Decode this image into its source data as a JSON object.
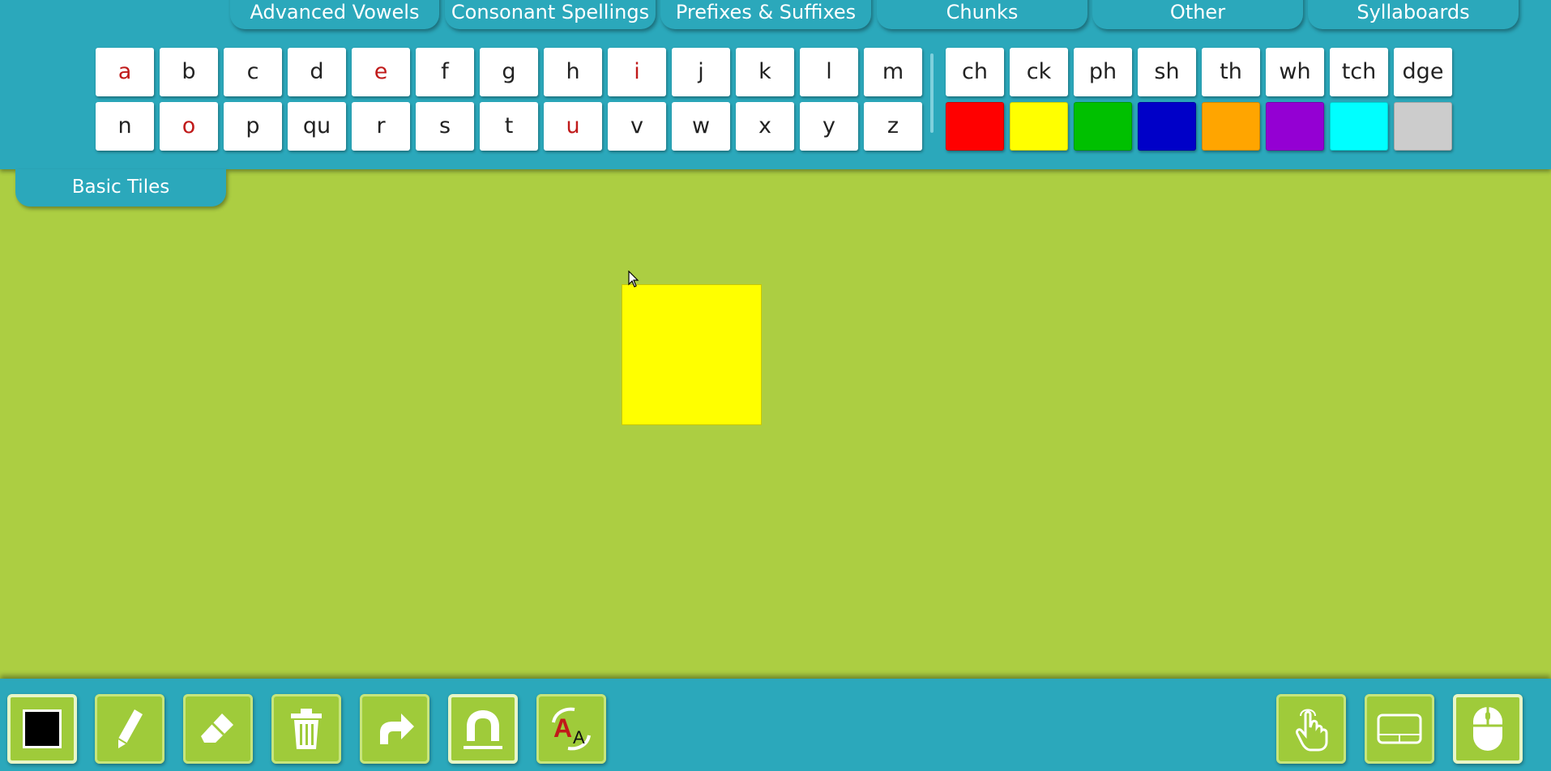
{
  "category_tabs": [
    "Advanced Vowels",
    "Consonant Spellings",
    "Prefixes & Suffixes",
    "Chunks",
    "Other",
    "Syllaboards"
  ],
  "letters_row1": [
    "a",
    "b",
    "c",
    "d",
    "e",
    "f",
    "g",
    "h",
    "i",
    "j",
    "k",
    "l",
    "m"
  ],
  "letters_row2": [
    "n",
    "o",
    "p",
    "qu",
    "r",
    "s",
    "t",
    "u",
    "v",
    "w",
    "x",
    "y",
    "z"
  ],
  "digraphs": [
    "ch",
    "ck",
    "ph",
    "sh",
    "th",
    "wh",
    "tch",
    "dge"
  ],
  "vowels": [
    "a",
    "e",
    "i",
    "o",
    "u"
  ],
  "swatches": [
    "#ff0000",
    "#ffff00",
    "#00c000",
    "#0000c8",
    "#ffa500",
    "#9400d3",
    "#00ffff",
    "#cccccc"
  ],
  "basic_tiles_label": "Basic Tiles",
  "placed_tile_color": "#ffff00",
  "toolbar": {
    "color_icon": "color-picker-icon",
    "pencil_icon": "pencil-icon",
    "eraser_icon": "eraser-icon",
    "trash_icon": "trash-icon",
    "redo_icon": "redo-arrow-icon",
    "magnet_icon": "magnet-icon",
    "case_icon": "case-toggle-icon",
    "touch_icon": "touch-icon",
    "trackpad_icon": "trackpad-icon",
    "mouse_icon": "mouse-icon",
    "current_color": "#000000"
  },
  "colors": {
    "panel": "#2ba8bb",
    "workspace": "#acce42",
    "tool_bg": "#9fcb3a",
    "vowel_text": "#c01a1a"
  }
}
